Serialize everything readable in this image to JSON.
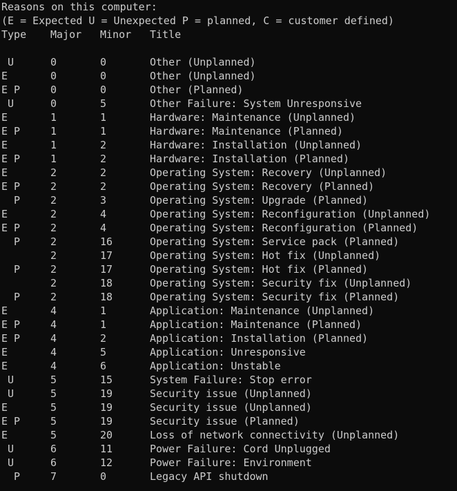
{
  "console": {
    "line1": "Reasons on this computer:",
    "line2": "(E = Expected U = Unexpected P = planned, C = customer defined)",
    "headers": {
      "type": "Type",
      "major": "Major",
      "minor": "Minor",
      "title": "Title"
    },
    "colors": {
      "background": "#0c0c0c",
      "text": "#cccccc"
    },
    "rows": [
      {
        "type": " U",
        "major": "0",
        "minor": "0",
        "title": "Other (Unplanned)"
      },
      {
        "type": "E",
        "major": "0",
        "minor": "0",
        "title": "Other (Unplanned)"
      },
      {
        "type": "E P",
        "major": "0",
        "minor": "0",
        "title": "Other (Planned)"
      },
      {
        "type": " U",
        "major": "0",
        "minor": "5",
        "title": "Other Failure: System Unresponsive"
      },
      {
        "type": "E",
        "major": "1",
        "minor": "1",
        "title": "Hardware: Maintenance (Unplanned)"
      },
      {
        "type": "E P",
        "major": "1",
        "minor": "1",
        "title": "Hardware: Maintenance (Planned)"
      },
      {
        "type": "E",
        "major": "1",
        "minor": "2",
        "title": "Hardware: Installation (Unplanned)"
      },
      {
        "type": "E P",
        "major": "1",
        "minor": "2",
        "title": "Hardware: Installation (Planned)"
      },
      {
        "type": "E",
        "major": "2",
        "minor": "2",
        "title": "Operating System: Recovery (Unplanned)"
      },
      {
        "type": "E P",
        "major": "2",
        "minor": "2",
        "title": "Operating System: Recovery (Planned)"
      },
      {
        "type": "  P",
        "major": "2",
        "minor": "3",
        "title": "Operating System: Upgrade (Planned)"
      },
      {
        "type": "E",
        "major": "2",
        "minor": "4",
        "title": "Operating System: Reconfiguration (Unplanned)"
      },
      {
        "type": "E P",
        "major": "2",
        "minor": "4",
        "title": "Operating System: Reconfiguration (Planned)"
      },
      {
        "type": "  P",
        "major": "2",
        "minor": "16",
        "title": "Operating System: Service pack (Planned)"
      },
      {
        "type": "",
        "major": "2",
        "minor": "17",
        "title": "Operating System: Hot fix (Unplanned)"
      },
      {
        "type": "  P",
        "major": "2",
        "minor": "17",
        "title": "Operating System: Hot fix (Planned)"
      },
      {
        "type": "",
        "major": "2",
        "minor": "18",
        "title": "Operating System: Security fix (Unplanned)"
      },
      {
        "type": "  P",
        "major": "2",
        "minor": "18",
        "title": "Operating System: Security fix (Planned)"
      },
      {
        "type": "E",
        "major": "4",
        "minor": "1",
        "title": "Application: Maintenance (Unplanned)"
      },
      {
        "type": "E P",
        "major": "4",
        "minor": "1",
        "title": "Application: Maintenance (Planned)"
      },
      {
        "type": "E P",
        "major": "4",
        "minor": "2",
        "title": "Application: Installation (Planned)"
      },
      {
        "type": "E",
        "major": "4",
        "minor": "5",
        "title": "Application: Unresponsive"
      },
      {
        "type": "E",
        "major": "4",
        "minor": "6",
        "title": "Application: Unstable"
      },
      {
        "type": " U",
        "major": "5",
        "minor": "15",
        "title": "System Failure: Stop error"
      },
      {
        "type": " U",
        "major": "5",
        "minor": "19",
        "title": "Security issue (Unplanned)"
      },
      {
        "type": "E",
        "major": "5",
        "minor": "19",
        "title": "Security issue (Unplanned)"
      },
      {
        "type": "E P",
        "major": "5",
        "minor": "19",
        "title": "Security issue (Planned)"
      },
      {
        "type": "E",
        "major": "5",
        "minor": "20",
        "title": "Loss of network connectivity (Unplanned)"
      },
      {
        "type": " U",
        "major": "6",
        "minor": "11",
        "title": "Power Failure: Cord Unplugged"
      },
      {
        "type": " U",
        "major": "6",
        "minor": "12",
        "title": "Power Failure: Environment"
      },
      {
        "type": "  P",
        "major": "7",
        "minor": "0",
        "title": "Legacy API shutdown"
      }
    ]
  }
}
